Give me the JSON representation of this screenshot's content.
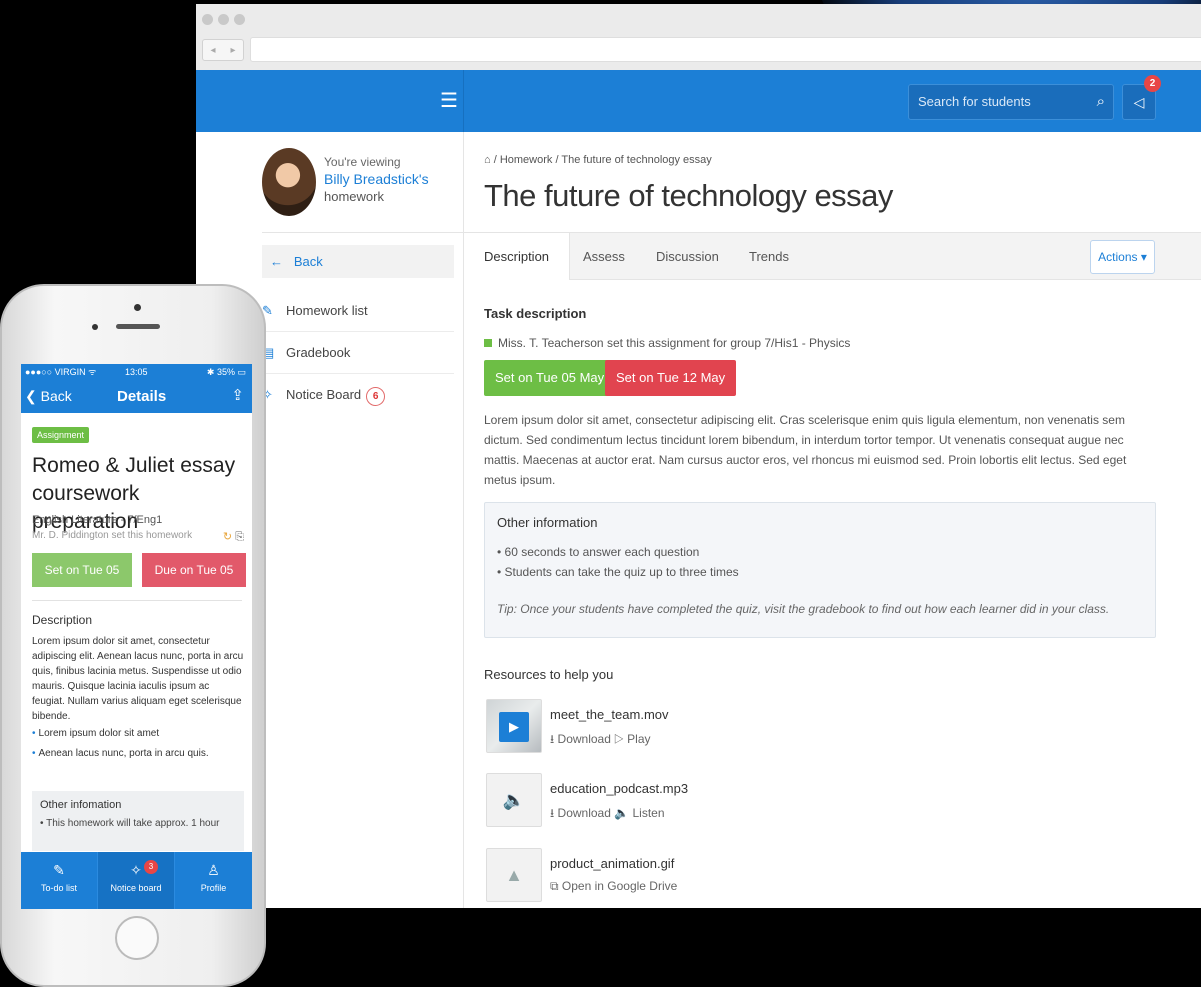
{
  "browser": {
    "search_placeholder": "Search for students",
    "notification_count": "2",
    "viewing": {
      "prefix": "You're viewing",
      "name": "Billy Breadstick's",
      "suffix": "homework"
    },
    "sidebar": {
      "back": "Back",
      "items": [
        {
          "label": "Homework list",
          "icon": "edit-icon"
        },
        {
          "label": "Gradebook",
          "icon": "gradebook-icon"
        },
        {
          "label": "Notice Board",
          "icon": "pin-icon",
          "badge": "6"
        }
      ]
    },
    "breadcrumb": "/ Homework / The future of technology essay",
    "title": "The future of technology essay",
    "tabs": [
      "Description",
      "Assess",
      "Discussion",
      "Trends"
    ],
    "actions_label": "Actions ▾",
    "task_heading": "Task description",
    "set_by": "Miss. T. Teacherson set this assignment for group 7/His1 - Physics",
    "set_on": "Set on Tue 05 May",
    "due_on": "Set on Tue 12 May",
    "description": "Lorem ipsum dolor sit amet, consectetur adipiscing elit. Cras scelerisque enim quis ligula elementum, non venenatis sem dictum. Sed condimentum lectus tincidunt lorem bibendum, in interdum tortor tempor. Ut venenatis consequat augue nec mattis. Maecenas at auctor erat. Nam cursus auctor eros, vel rhoncus mi euismod sed. Proin lobortis elit lectus. Sed eget metus ipsum.",
    "other_info": {
      "heading": "Other information",
      "items": [
        "• 60 seconds to answer each question",
        "• Students can take the quiz up to three times"
      ],
      "tip": "Tip: Once your students have completed the quiz, visit the gradebook to find out how each learner did in your class."
    },
    "resources_heading": "Resources to help you",
    "resources": [
      {
        "name": "meet_the_team.mov",
        "links": "⭳ Download  ▷ Play",
        "icon": "video-icon"
      },
      {
        "name": "education_podcast.mp3",
        "links": "⭳ Download  🔈 Listen",
        "icon": "audio-icon"
      },
      {
        "name": "product_animation.gif",
        "links": "⧉ Open in Google Drive",
        "icon": "google-drive-icon"
      }
    ]
  },
  "phone": {
    "status": {
      "carrier": "●●●○○ VIRGIN ᯤ",
      "time": "13:05",
      "battery": "✱ 35%"
    },
    "nav": {
      "back": "❮ Back",
      "title": "Details"
    },
    "tag": "Assignment",
    "title": "Romeo & Juliet essay coursework preparation",
    "subject": "English Literature - 7/Eng1",
    "set_by": "Mr. D. Piddington set this homework",
    "set_on": "Set on Tue 05 May",
    "due_on": "Due on Tue 05 May",
    "desc_heading": "Description",
    "description": "Lorem ipsum dolor sit amet, consectetur adipiscing elit. Aenean lacus nunc, porta in arcu quis, finibus lacinia metus. Suspendisse ut odio mauris. Quisque lacinia iaculis ipsum ac feugiat. Nullam varius aliquam eget scelerisque bibende.",
    "bullets": [
      "Lorem ipsum dolor sit amet",
      "Aenean lacus nunc, porta in arcu quis."
    ],
    "other_heading": "Other infomation",
    "other_text": "• This homework will take approx. 1 hour",
    "tabbar": [
      {
        "label": "To-do list",
        "icon": "todo-icon"
      },
      {
        "label": "Notice board",
        "icon": "pin-icon",
        "badge": "3"
      },
      {
        "label": "Profile",
        "icon": "profile-icon"
      }
    ]
  },
  "colors": {
    "primary": "#1c7fd6",
    "green": "#6dbe45",
    "red": "#e1444f"
  }
}
